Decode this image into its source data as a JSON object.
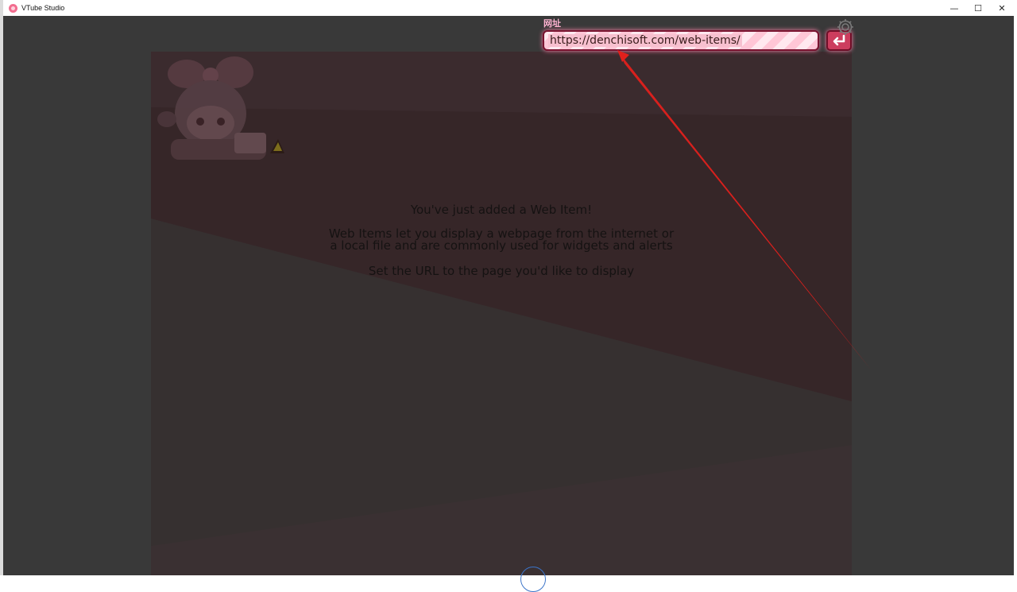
{
  "window": {
    "title": "VTube Studio",
    "minimize_glyph": "—",
    "maximize_glyph": "☐",
    "close_glyph": "✕"
  },
  "url_bar": {
    "label": "网址",
    "value": "https://denchisoft.com/web-items/"
  },
  "web_item": {
    "heading": "You've just added a Web Item!",
    "body_line1": "Web Items let you display a webpage from the internet or",
    "body_line2": "a local file and are commonly used for widgets and alerts",
    "cta": "Set the URL to the page you'd like to display"
  },
  "icons": {
    "app": "vtube-studio-app-icon",
    "enter": "enter-return-icon",
    "settings": "gear-icon"
  },
  "colors": {
    "app_background": "#393939",
    "panel_background": "#363030",
    "accent_pink": "#ffb3d1",
    "annotation_arrow": "#e0201c"
  }
}
